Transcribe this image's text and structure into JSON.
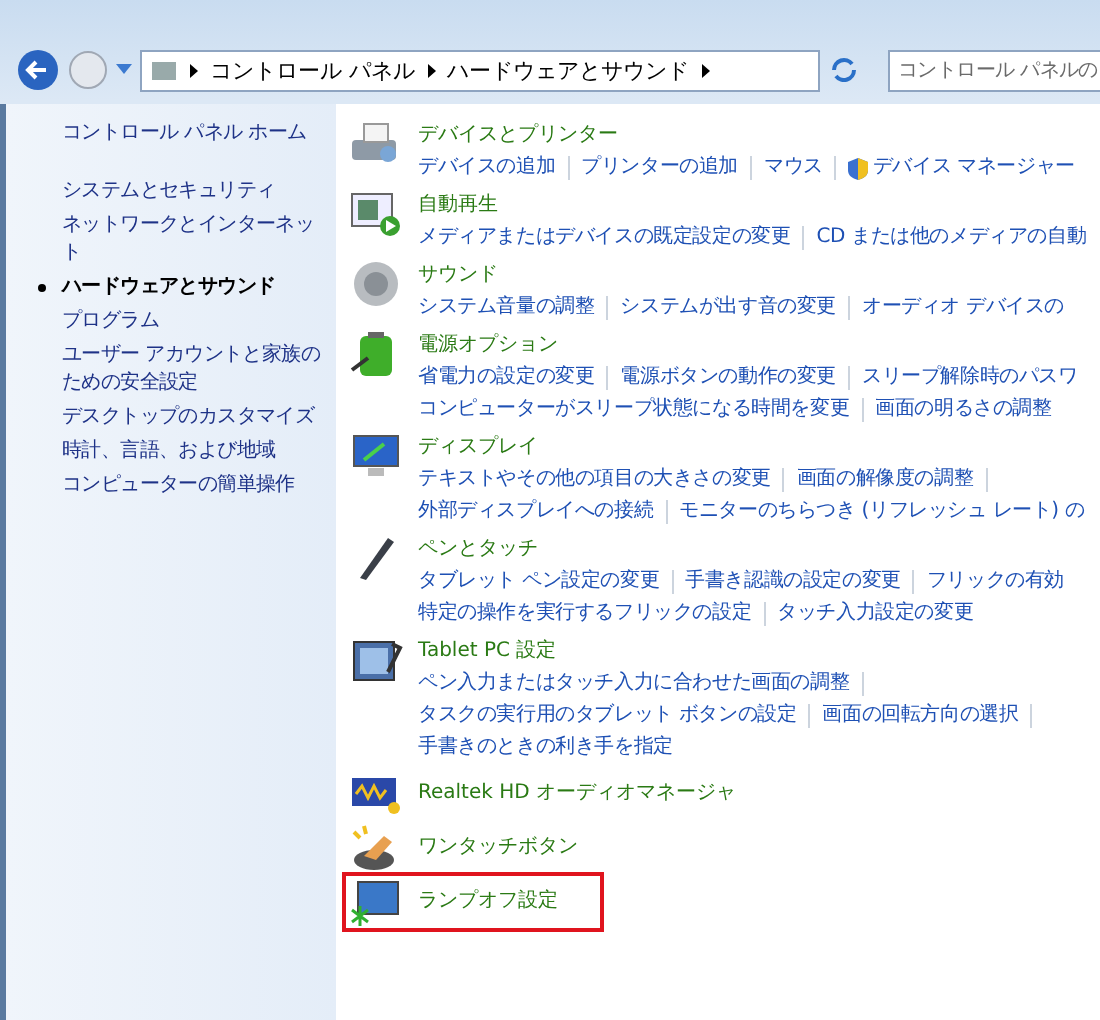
{
  "address": {
    "path": [
      "コントロール パネル",
      "ハードウェアとサウンド"
    ],
    "search_placeholder": "コントロール パネルの"
  },
  "sidebar": {
    "home": "コントロール パネル ホーム",
    "items": [
      {
        "label": "システムとセキュリティ",
        "selected": false
      },
      {
        "label": "ネットワークとインターネット",
        "selected": false
      },
      {
        "label": "ハードウェアとサウンド",
        "selected": true
      },
      {
        "label": "プログラム",
        "selected": false
      },
      {
        "label": "ユーザー アカウントと家族のための安全設定",
        "selected": false
      },
      {
        "label": "デスクトップのカスタマイズ",
        "selected": false
      },
      {
        "label": "時計、言語、および地域",
        "selected": false
      },
      {
        "label": "コンピューターの簡単操作",
        "selected": false
      }
    ]
  },
  "categories": [
    {
      "title": "デバイスとプリンター",
      "highlighted": false,
      "lines": [
        {
          "links": [
            {
              "label": "デバイスの追加"
            },
            {
              "label": "プリンターの追加"
            },
            {
              "label": "マウス"
            },
            {
              "label": "デバイス マネージャー",
              "shield": true
            }
          ]
        }
      ]
    },
    {
      "title": "自動再生",
      "highlighted": false,
      "lines": [
        {
          "links": [
            {
              "label": "メディアまたはデバイスの既定設定の変更"
            },
            {
              "label": "CD または他のメディアの自動"
            }
          ]
        }
      ]
    },
    {
      "title": "サウンド",
      "highlighted": false,
      "lines": [
        {
          "links": [
            {
              "label": "システム音量の調整"
            },
            {
              "label": "システムが出す音の変更"
            },
            {
              "label": "オーディオ デバイスの"
            }
          ]
        }
      ]
    },
    {
      "title": "電源オプション",
      "highlighted": false,
      "lines": [
        {
          "links": [
            {
              "label": "省電力の設定の変更"
            },
            {
              "label": "電源ボタンの動作の変更"
            },
            {
              "label": "スリープ解除時のパスワ"
            }
          ]
        },
        {
          "links": [
            {
              "label": "コンピューターがスリープ状態になる時間を変更"
            },
            {
              "label": "画面の明るさの調整"
            }
          ]
        }
      ]
    },
    {
      "title": "ディスプレイ",
      "highlighted": false,
      "lines": [
        {
          "links": [
            {
              "label": "テキストやその他の項目の大きさの変更"
            },
            {
              "label": "画面の解像度の調整"
            }
          ],
          "trailing_bar": true
        },
        {
          "links": [
            {
              "label": "外部ディスプレイへの接続"
            },
            {
              "label": "モニターのちらつき (リフレッシュ レート) の"
            }
          ]
        }
      ]
    },
    {
      "title": "ペンとタッチ",
      "highlighted": false,
      "lines": [
        {
          "links": [
            {
              "label": "タブレット ペン設定の変更"
            },
            {
              "label": "手書き認識の設定の変更"
            },
            {
              "label": "フリックの有効"
            }
          ]
        },
        {
          "links": [
            {
              "label": "特定の操作を実行するフリックの設定"
            },
            {
              "label": "タッチ入力設定の変更"
            }
          ]
        }
      ]
    },
    {
      "title": "Tablet PC 設定",
      "highlighted": false,
      "lines": [
        {
          "links": [
            {
              "label": "ペン入力またはタッチ入力に合わせた画面の調整"
            }
          ],
          "trailing_bar": true
        },
        {
          "links": [
            {
              "label": "タスクの実行用のタブレット ボタンの設定"
            },
            {
              "label": "画面の回転方向の選択"
            }
          ],
          "trailing_bar": true
        },
        {
          "links": [
            {
              "label": "手書きのときの利き手を指定"
            }
          ]
        }
      ]
    },
    {
      "title": "Realtek HD オーディオマネージャ",
      "highlighted": false
    },
    {
      "title": "ワンタッチボタン",
      "highlighted": false
    },
    {
      "title": "ランプオフ設定",
      "highlighted": true
    }
  ]
}
